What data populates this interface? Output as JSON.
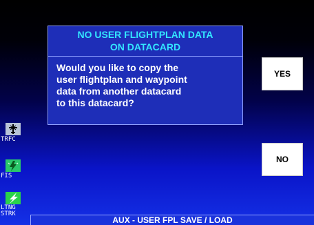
{
  "dialog": {
    "title_line1": "NO USER FLIGHTPLAN DATA",
    "title_line2": "ON DATACARD",
    "message_lines": [
      "Would you like to copy the",
      "user flightplan and waypoint",
      "data from another datacard",
      "to this datacard?"
    ]
  },
  "softkeys": {
    "yes_label": "YES",
    "no_label": "NO"
  },
  "side_tabs": [
    {
      "label": "TRFC",
      "icon": "traffic-icon"
    },
    {
      "label": "FIS",
      "icon": "fis-icon"
    },
    {
      "label_line1": "LTNG",
      "label_line2": "STRK",
      "icon": "lightning-icon"
    }
  ],
  "status_bar": {
    "label": "AUX - USER FPL SAVE / LOAD"
  },
  "colors": {
    "title_text": "#33e6ff",
    "dialog_bg": "#1e2eb8",
    "softkey_bg": "#ffffff",
    "status_bg": "#1a32dc"
  }
}
